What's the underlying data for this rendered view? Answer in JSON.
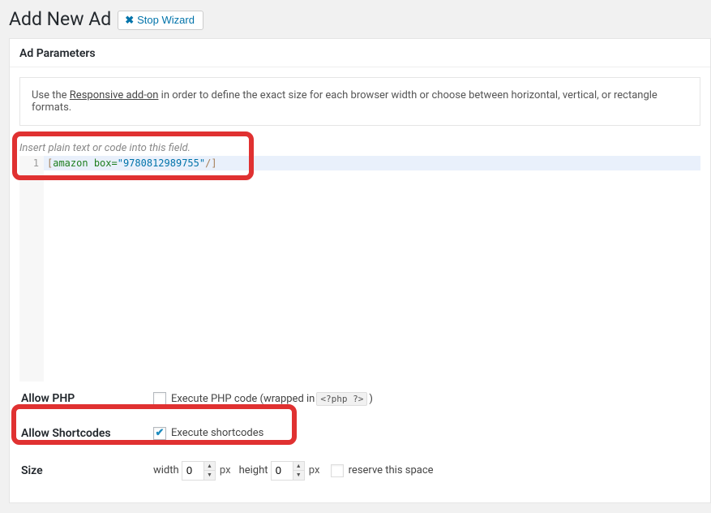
{
  "header": {
    "title": "Add New Ad",
    "stop_wizard_label": "Stop Wizard"
  },
  "panel": {
    "title": "Ad Parameters",
    "notice_pre": "Use the ",
    "notice_link": "Responsive add-on",
    "notice_post": " in order to define the exact size for each browser width or choose between horizontal, vertical, or rectangle formats."
  },
  "editor": {
    "placeholder": "Insert plain text or code into this field.",
    "line_number": "1",
    "code_open_br": "[",
    "code_tag": "amazon",
    "code_attr": "box=",
    "code_str": "\"9780812989755\"",
    "code_slash": "/",
    "code_close_br": "]"
  },
  "options": {
    "allow_php": {
      "label": "Allow PHP",
      "desc_pre": "Execute PHP code (wrapped in ",
      "chip": "<?php ?>",
      "desc_post": " )",
      "checked": false
    },
    "allow_shortcodes": {
      "label": "Allow Shortcodes",
      "desc": "Execute shortcodes",
      "checked": true
    },
    "size": {
      "label": "Size",
      "width_label": "width",
      "width_value": "0",
      "height_label": "height",
      "height_value": "0",
      "unit": "px",
      "reserve_label": "reserve this space",
      "reserve_checked": false
    }
  }
}
